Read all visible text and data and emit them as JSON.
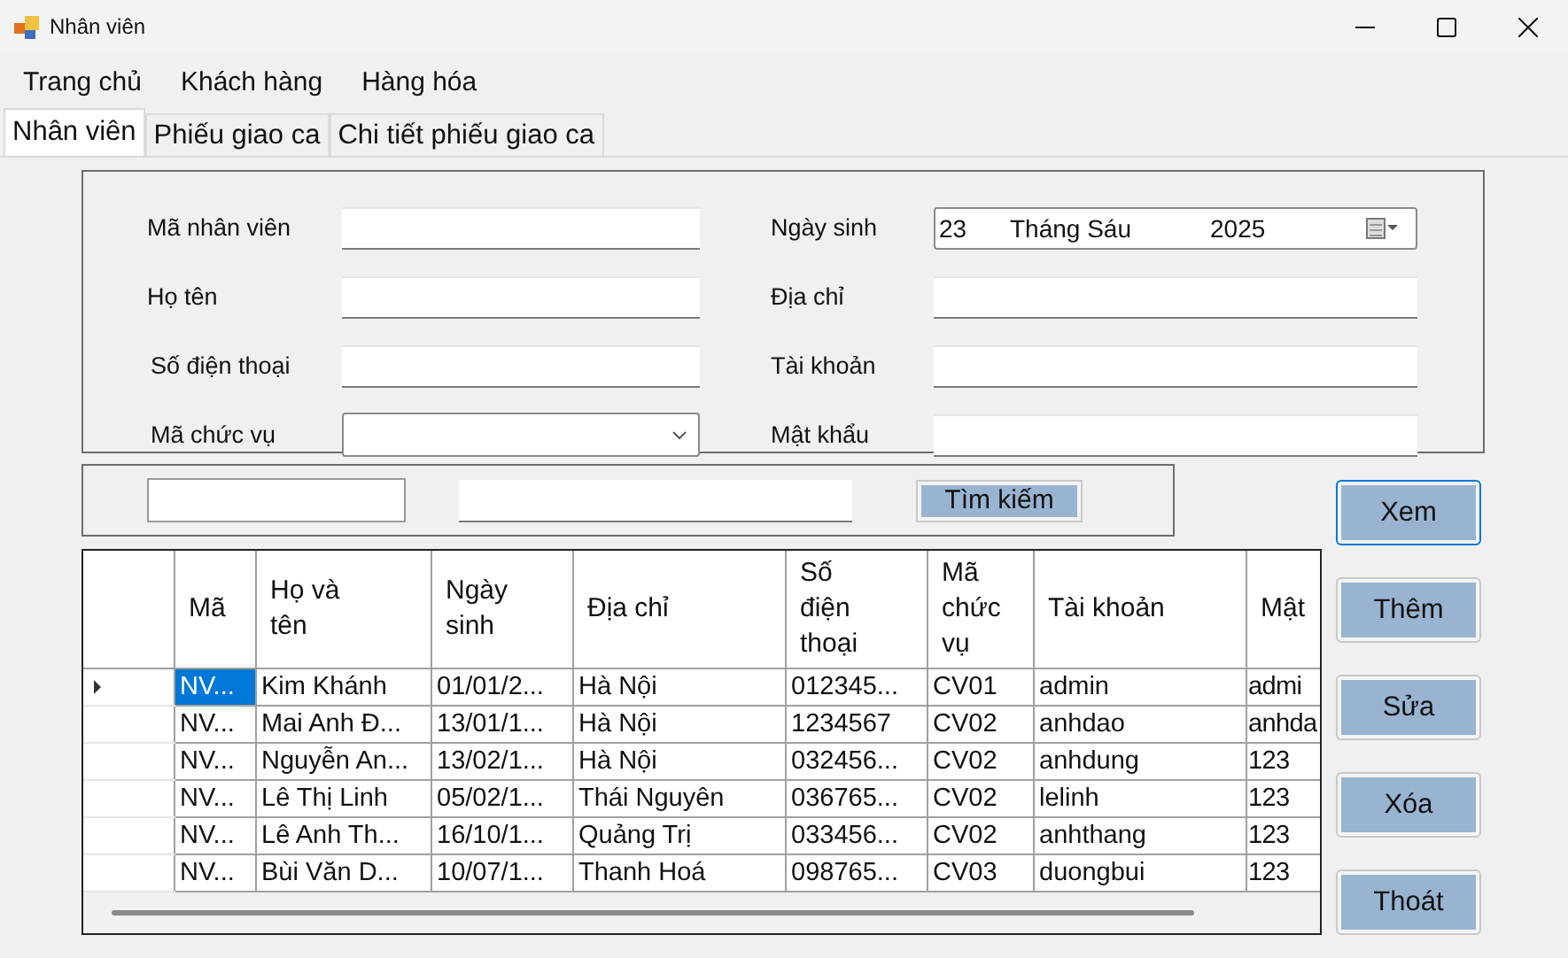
{
  "window": {
    "title": "Nhân viên"
  },
  "menu": [
    "Trang chủ",
    "Khách hàng",
    "Hàng hóa"
  ],
  "tabs": [
    {
      "label": "Nhân viên",
      "selected": true
    },
    {
      "label": "Phiếu giao ca",
      "selected": false
    },
    {
      "label": "Chi tiết phiếu giao ca",
      "selected": false
    }
  ],
  "form": {
    "left": [
      {
        "label": "Mã nhân viên",
        "kind": "text"
      },
      {
        "label": "Họ tên",
        "kind": "text"
      },
      {
        "label": "Số điện thoại",
        "kind": "text"
      },
      {
        "label": "Mã chức vụ",
        "kind": "combo"
      }
    ],
    "right": [
      {
        "label": "Ngày sinh",
        "kind": "date",
        "day": "23",
        "month": "Tháng Sáu",
        "year": "2025"
      },
      {
        "label": "Địa chỉ",
        "kind": "text"
      },
      {
        "label": "Tài khoản",
        "kind": "text"
      },
      {
        "label": "Mật khẩu",
        "kind": "text"
      }
    ]
  },
  "search": {
    "button": "Tìm kiếm"
  },
  "table": {
    "columns": [
      "Mã",
      "Họ và tên",
      "Ngày sinh",
      "Địa chỉ",
      "Số điện thoại",
      "Mã chức vụ",
      "Tài khoản",
      "Mật"
    ],
    "rows": [
      {
        "selected": true,
        "cells": [
          "NV...",
          "Kim Khánh",
          "01/01/2...",
          "Hà Nội",
          "012345...",
          "CV01",
          "admin",
          "admi"
        ]
      },
      {
        "selected": false,
        "cells": [
          "NV...",
          "Mai Anh Đ...",
          "13/01/1...",
          "Hà Nội",
          "1234567",
          "CV02",
          "anhdao",
          "anhda"
        ]
      },
      {
        "selected": false,
        "cells": [
          "NV...",
          "Nguyễn An...",
          "13/02/1...",
          "Hà Nội",
          "032456...",
          "CV02",
          "anhdung",
          "123"
        ]
      },
      {
        "selected": false,
        "cells": [
          "NV...",
          "Lê Thị Linh",
          "05/02/1...",
          "Thái Nguyên",
          "036765...",
          "CV02",
          "lelinh",
          "123"
        ]
      },
      {
        "selected": false,
        "cells": [
          "NV...",
          "Lê Anh Th...",
          "16/10/1...",
          "Quảng Trị",
          "033456...",
          "CV02",
          "anhthang",
          "123"
        ]
      },
      {
        "selected": false,
        "cells": [
          "NV...",
          "Bùi Văn D...",
          "10/07/1...",
          "Thanh Hoá",
          "098765...",
          "CV03",
          "duongbui",
          "123"
        ]
      }
    ]
  },
  "buttons": [
    {
      "label": "Xem",
      "focused": true
    },
    {
      "label": "Thêm",
      "focused": false
    },
    {
      "label": "Sửa",
      "focused": false
    },
    {
      "label": "Xóa",
      "focused": false
    },
    {
      "label": "Thoát",
      "focused": false
    }
  ]
}
